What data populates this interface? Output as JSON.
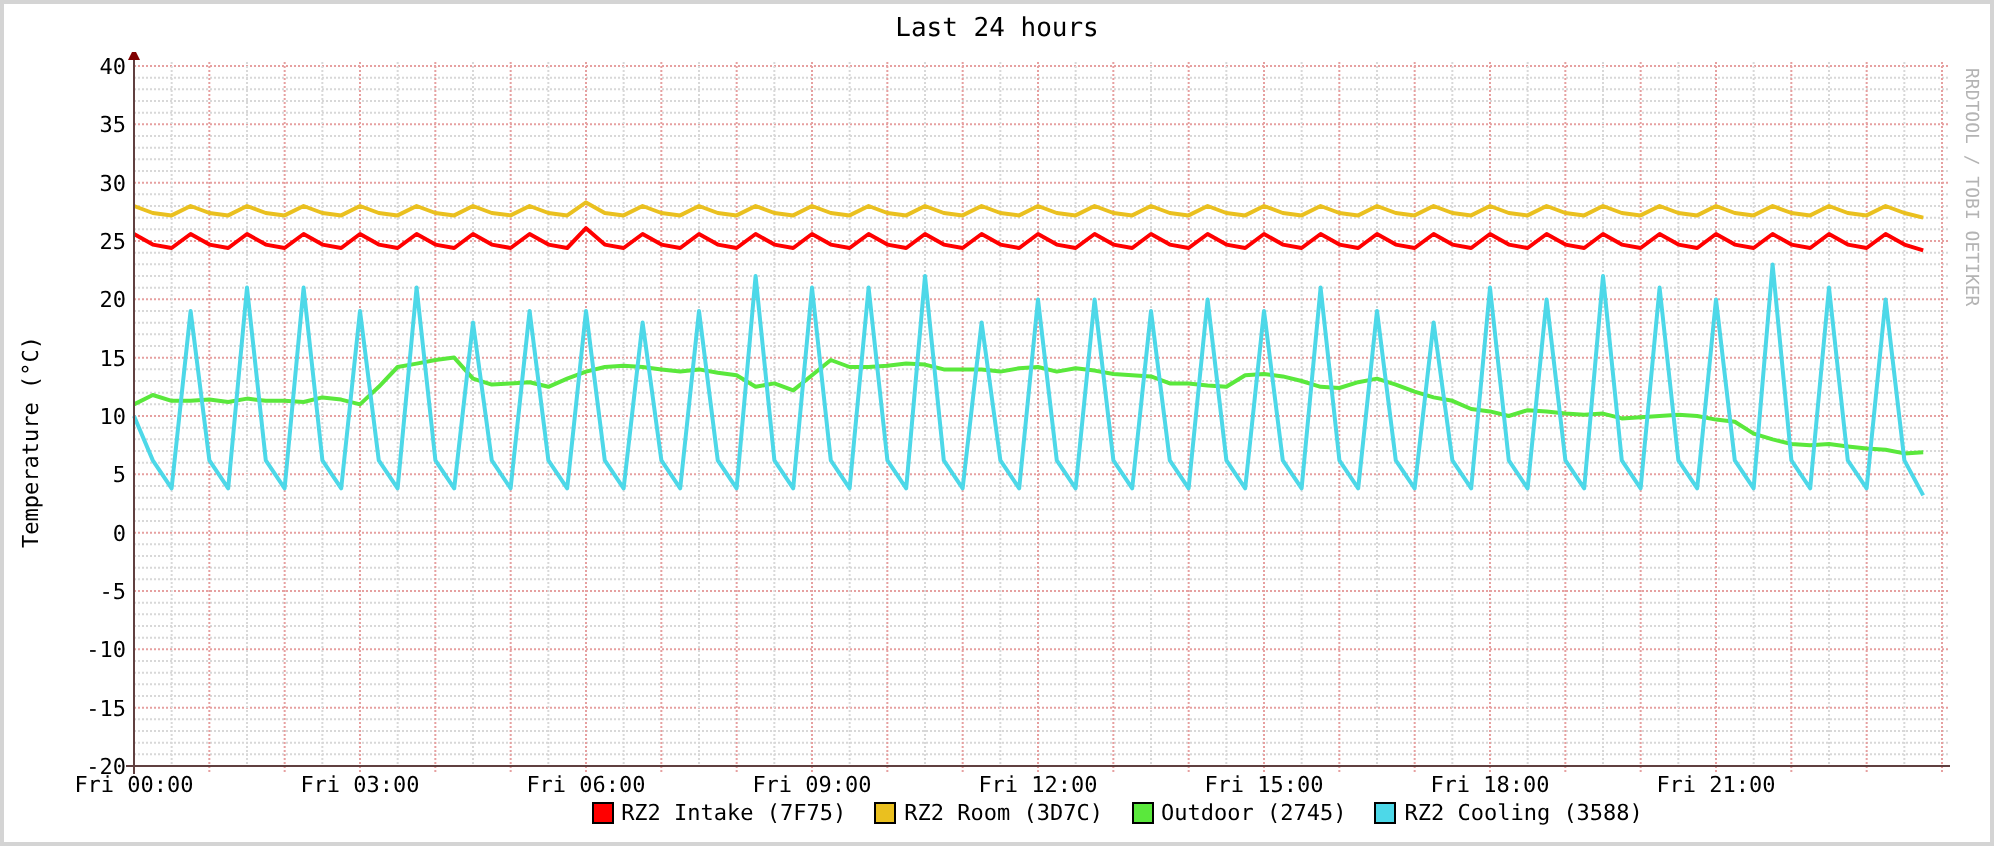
{
  "chart_data": {
    "type": "line",
    "title": "Last 24 hours",
    "ylabel": "Temperature (°C)",
    "ylim": [
      -20,
      40
    ],
    "grid": true,
    "yticks": [
      -20,
      -15,
      -10,
      -5,
      0,
      5,
      10,
      15,
      20,
      25,
      30,
      35,
      40
    ],
    "categories": [
      "Fri 00:00",
      null,
      null,
      null,
      null,
      null,
      null,
      null,
      null,
      null,
      null,
      null,
      "Fri 03:00",
      null,
      null,
      null,
      null,
      null,
      null,
      null,
      null,
      null,
      null,
      null,
      "Fri 06:00",
      null,
      null,
      null,
      null,
      null,
      null,
      null,
      null,
      null,
      null,
      null,
      "Fri 09:00",
      null,
      null,
      null,
      null,
      null,
      null,
      null,
      null,
      null,
      null,
      null,
      "Fri 12:00",
      null,
      null,
      null,
      null,
      null,
      null,
      null,
      null,
      null,
      null,
      null,
      "Fri 15:00",
      null,
      null,
      null,
      null,
      null,
      null,
      null,
      null,
      null,
      null,
      null,
      "Fri 18:00",
      null,
      null,
      null,
      null,
      null,
      null,
      null,
      null,
      null,
      null,
      null,
      "Fri 21:00",
      null,
      null,
      null,
      null,
      null,
      null,
      null,
      null,
      null,
      null,
      null
    ],
    "series": [
      {
        "name": "RZ2 Intake (7F75)",
        "color": "#ff0000",
        "values": [
          25.6,
          24.7,
          24.4,
          25.6,
          24.7,
          24.4,
          25.6,
          24.7,
          24.4,
          25.6,
          24.7,
          24.4,
          25.6,
          24.7,
          24.4,
          25.6,
          24.7,
          24.4,
          25.6,
          24.7,
          24.4,
          25.6,
          24.7,
          24.4,
          26.1,
          24.7,
          24.4,
          25.6,
          24.7,
          24.4,
          25.6,
          24.7,
          24.4,
          25.6,
          24.7,
          24.4,
          25.6,
          24.7,
          24.4,
          25.6,
          24.7,
          24.4,
          25.6,
          24.7,
          24.4,
          25.6,
          24.7,
          24.4,
          25.6,
          24.7,
          24.4,
          25.6,
          24.7,
          24.4,
          25.6,
          24.7,
          24.4,
          25.6,
          24.7,
          24.4,
          25.6,
          24.7,
          24.4,
          25.6,
          24.7,
          24.4,
          25.6,
          24.7,
          24.4,
          25.6,
          24.7,
          24.4,
          25.6,
          24.7,
          24.4,
          25.6,
          24.7,
          24.4,
          25.6,
          24.7,
          24.4,
          25.6,
          24.7,
          24.4,
          25.6,
          24.7,
          24.4,
          25.6,
          24.7,
          24.4,
          25.6,
          24.7,
          24.4,
          25.6,
          24.7,
          24.2
        ]
      },
      {
        "name": "RZ2 Room (3D7C)",
        "color": "#eac01f",
        "values": [
          28.0,
          27.4,
          27.2,
          28.0,
          27.4,
          27.2,
          28.0,
          27.4,
          27.2,
          28.0,
          27.4,
          27.2,
          28.0,
          27.4,
          27.2,
          28.0,
          27.4,
          27.2,
          28.0,
          27.4,
          27.2,
          28.0,
          27.4,
          27.2,
          28.3,
          27.4,
          27.2,
          28.0,
          27.4,
          27.2,
          28.0,
          27.4,
          27.2,
          28.0,
          27.4,
          27.2,
          28.0,
          27.4,
          27.2,
          28.0,
          27.4,
          27.2,
          28.0,
          27.4,
          27.2,
          28.0,
          27.4,
          27.2,
          28.0,
          27.4,
          27.2,
          28.0,
          27.4,
          27.2,
          28.0,
          27.4,
          27.2,
          28.0,
          27.4,
          27.2,
          28.0,
          27.4,
          27.2,
          28.0,
          27.4,
          27.2,
          28.0,
          27.4,
          27.2,
          28.0,
          27.4,
          27.2,
          28.0,
          27.4,
          27.2,
          28.0,
          27.4,
          27.2,
          28.0,
          27.4,
          27.2,
          28.0,
          27.4,
          27.2,
          28.0,
          27.4,
          27.2,
          28.0,
          27.4,
          27.2,
          28.0,
          27.4,
          27.2,
          28.0,
          27.4,
          27.0
        ]
      },
      {
        "name": "Outdoor (2745)",
        "color": "#5ae83c",
        "values": [
          11,
          11.8,
          11.3,
          11.3,
          11.4,
          11.2,
          11.5,
          11.3,
          11.3,
          11.2,
          11.6,
          11.4,
          11,
          12.5,
          14.2,
          14.5,
          14.8,
          15,
          13.2,
          12.7,
          12.8,
          12.9,
          12.5,
          13.2,
          13.8,
          14.2,
          14.3,
          14.2,
          14,
          13.8,
          14,
          13.7,
          13.5,
          12.5,
          12.8,
          12.2,
          13.5,
          14.8,
          14.2,
          14.2,
          14.3,
          14.5,
          14.4,
          14,
          14,
          14,
          13.8,
          14.1,
          14.2,
          13.8,
          14.1,
          13.9,
          13.6,
          13.5,
          13.4,
          12.8,
          12.8,
          12.6,
          12.5,
          13.5,
          13.6,
          13.4,
          13,
          12.5,
          12.4,
          12.9,
          13.2,
          12.7,
          12.1,
          11.6,
          11.3,
          10.6,
          10.4,
          10,
          10.5,
          10.4,
          10.2,
          10.1,
          10.2,
          9.8,
          9.9,
          10,
          10.1,
          10,
          9.7,
          9.5,
          8.5,
          8,
          7.6,
          7.5,
          7.6,
          7.4,
          7.2,
          7.1,
          6.8,
          6.9
        ]
      },
      {
        "name": "RZ2 Cooling (3588)",
        "color": "#4dd8e8",
        "values": [
          10,
          6.2,
          3.8,
          19,
          6.2,
          3.8,
          21,
          6.2,
          3.8,
          21,
          6.2,
          3.8,
          19,
          6.2,
          3.8,
          21,
          6.2,
          3.8,
          18,
          6.2,
          3.8,
          19,
          6.2,
          3.8,
          19,
          6.2,
          3.8,
          18,
          6.2,
          3.8,
          19,
          6.2,
          3.8,
          22,
          6.2,
          3.8,
          21,
          6.2,
          3.8,
          21,
          6.2,
          3.8,
          22,
          6.2,
          3.8,
          18,
          6.2,
          3.8,
          20,
          6.2,
          3.8,
          20,
          6.2,
          3.8,
          19,
          6.2,
          3.8,
          20,
          6.2,
          3.8,
          19,
          6.2,
          3.8,
          21,
          6.2,
          3.8,
          19,
          6.2,
          3.8,
          18,
          6.2,
          3.8,
          21,
          6.2,
          3.8,
          20,
          6.2,
          3.8,
          22,
          6.2,
          3.8,
          21,
          6.2,
          3.8,
          20,
          6.2,
          3.8,
          23,
          6.2,
          3.8,
          21,
          6.2,
          3.8,
          20,
          6.2,
          3.2
        ]
      }
    ]
  },
  "credit": "RRDTOOL / TOBI OETIKER"
}
